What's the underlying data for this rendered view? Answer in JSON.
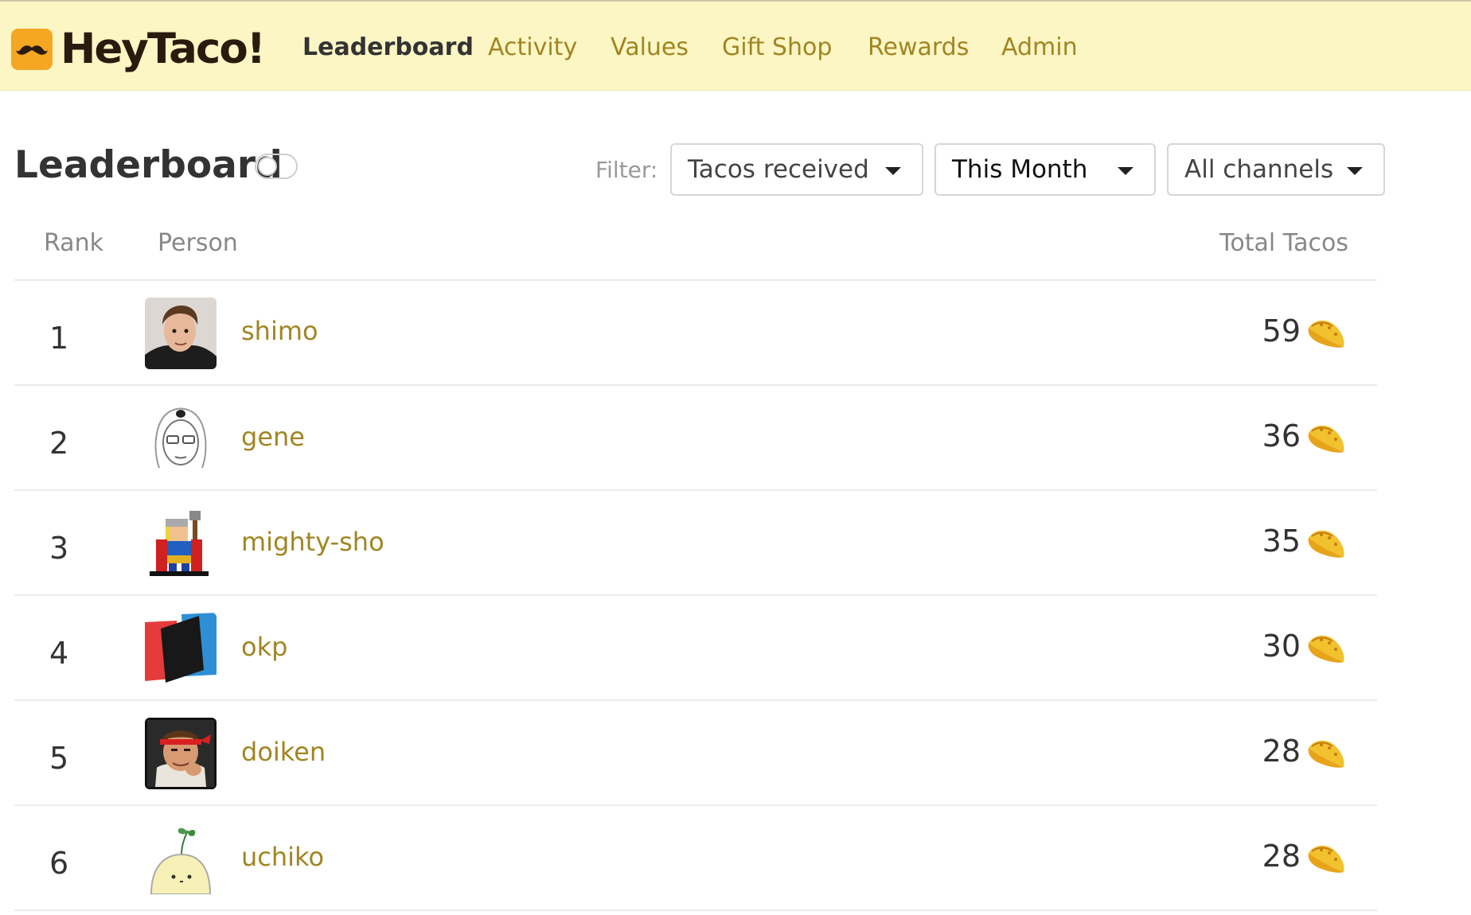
{
  "app": {
    "logo_text": "HeyTaco!",
    "logo_icon": "taco-mustache-icon",
    "brand_color": "#f5a623",
    "nav_bg": "#fcf6c4",
    "link_color": "#a18523"
  },
  "nav": [
    {
      "label": "Leaderboard",
      "active": true
    },
    {
      "label": "Activity",
      "active": false
    },
    {
      "label": "Values",
      "active": false
    },
    {
      "label": "Gift Shop",
      "active": false
    },
    {
      "label": "Rewards",
      "active": false
    },
    {
      "label": "Admin",
      "active": false
    }
  ],
  "page": {
    "title": "Leaderboard",
    "filter_label": "Filter:",
    "filters": {
      "type": "Tacos received",
      "period": "This Month",
      "channel": "All channels"
    }
  },
  "table": {
    "headers": {
      "rank": "Rank",
      "person": "Person",
      "total": "Total Tacos"
    },
    "rows": [
      {
        "rank": "1",
        "name": "shimo",
        "total": "59",
        "avatar": "photo"
      },
      {
        "rank": "2",
        "name": "gene",
        "total": "36",
        "avatar": "sketch"
      },
      {
        "rank": "3",
        "name": "mighty-sho",
        "total": "35",
        "avatar": "pixel-thor"
      },
      {
        "rank": "4",
        "name": "okp",
        "total": "30",
        "avatar": "color-squares"
      },
      {
        "rank": "5",
        "name": "doiken",
        "total": "28",
        "avatar": "fighter"
      },
      {
        "rank": "6",
        "name": "uchiko",
        "total": "28",
        "avatar": "sprout"
      }
    ]
  }
}
